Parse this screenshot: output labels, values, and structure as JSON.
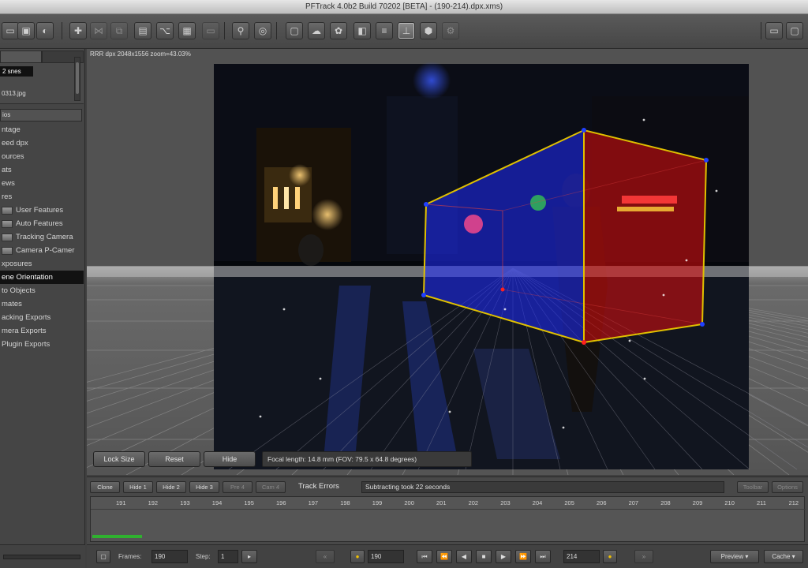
{
  "window": {
    "title": "PFTrack 4.0b2 Build 70202 [BETA] - (190-214).dpx.xms)"
  },
  "toolbar": {
    "buttons": [
      {
        "name": "open-clip-icon",
        "glyph": "▭"
      },
      {
        "name": "camera-icon",
        "glyph": "▣"
      },
      {
        "name": "mask-icon",
        "glyph": "◐"
      },
      {
        "name": "node-add-icon",
        "glyph": "✚"
      },
      {
        "name": "node-link-icon",
        "glyph": "⋈"
      },
      {
        "name": "node-tree-icon",
        "glyph": "⧉"
      },
      {
        "name": "node-grid-icon",
        "glyph": "▤"
      },
      {
        "name": "node-branch-icon",
        "glyph": "⌥"
      },
      {
        "name": "grid-view-icon",
        "glyph": "▦"
      },
      {
        "name": "frame-icon",
        "glyph": "▭"
      },
      {
        "name": "pin-icon",
        "glyph": "⚲"
      },
      {
        "name": "target-icon",
        "glyph": "◎"
      },
      {
        "name": "monitor-icon",
        "glyph": "▢"
      },
      {
        "name": "cloud-icon",
        "glyph": "☁"
      },
      {
        "name": "color-icon",
        "glyph": "✿"
      },
      {
        "name": "split-view-icon",
        "glyph": "◧"
      },
      {
        "name": "bars-icon",
        "glyph": "≡"
      },
      {
        "name": "axis-icon",
        "glyph": "⊥"
      },
      {
        "name": "object-icon",
        "glyph": "⬢"
      },
      {
        "name": "settings-icon",
        "glyph": "⚙"
      },
      {
        "name": "window-layout-icon",
        "glyph": "▭"
      },
      {
        "name": "fullscreen-icon",
        "glyph": "▢"
      }
    ]
  },
  "sidebar": {
    "selected_clip": "2 snes",
    "clip_file": "0313.jpg",
    "nodes_header": "ios",
    "items": [
      {
        "label": "ntage",
        "icon": ""
      },
      {
        "label": "eed dpx",
        "icon": ""
      },
      {
        "label": "ources",
        "icon": ""
      },
      {
        "label": "ats",
        "icon": ""
      },
      {
        "label": "ews",
        "icon": ""
      },
      {
        "label": "res",
        "icon": ""
      },
      {
        "label": "User Features",
        "icon": "▭"
      },
      {
        "label": "Auto Features",
        "icon": "▭"
      },
      {
        "label": "Tracking Camera",
        "icon": "▭"
      },
      {
        "label": "Camera P-Camer",
        "icon": "▭"
      },
      {
        "label": "xposures",
        "icon": ""
      },
      {
        "label": "ene Orientation",
        "icon": "",
        "selected": true
      },
      {
        "label": "to Objects",
        "icon": ""
      },
      {
        "label": "mates",
        "icon": ""
      },
      {
        "label": "acking Exports",
        "icon": ""
      },
      {
        "label": "mera Exports",
        "icon": ""
      },
      {
        "label": "Plugin Exports",
        "icon": ""
      }
    ]
  },
  "viewer": {
    "info": "RRR dpx 2048x1556 zoom=43.03%",
    "lock_size_label": "Lock Size",
    "reset_label": "Reset",
    "hide_label": "Hide",
    "focal_text": "Focal length: 14.8 mm (FOV: 79.5 x 64.8 degrees)"
  },
  "track": {
    "buttons": [
      {
        "label": "Clone",
        "dim": false
      },
      {
        "label": "Hide 1",
        "dim": false
      },
      {
        "label": "Hide 2",
        "dim": false
      },
      {
        "label": "Hide 3",
        "dim": false
      },
      {
        "label": "Pre 4",
        "dim": true
      },
      {
        "label": "Cam 4",
        "dim": true
      }
    ],
    "track_errors_label": "Track Errors",
    "status": "Subtracting took 22 seconds",
    "right_buttons": [
      {
        "label": "Toolbar",
        "dim": true
      },
      {
        "label": "Options",
        "dim": true
      }
    ],
    "ticks": [
      "191",
      "192",
      "193",
      "194",
      "195",
      "196",
      "197",
      "198",
      "199",
      "200",
      "201",
      "202",
      "203",
      "204",
      "205",
      "206",
      "207",
      "208",
      "209",
      "210",
      "211",
      "212"
    ],
    "progress": 0.07
  },
  "bottom": {
    "frames_label": "Frames:",
    "frames_value": "190",
    "step_label": "Step:",
    "step_value": "1",
    "start_field": "190",
    "end_field": "214",
    "preview_label": "Preview",
    "cache_label": "Cache"
  },
  "colors": {
    "cube_blue": "#1f2cff",
    "cube_red": "#e10d0d",
    "cube_edge": "#e0c000",
    "progress_green": "#2fb12f"
  }
}
